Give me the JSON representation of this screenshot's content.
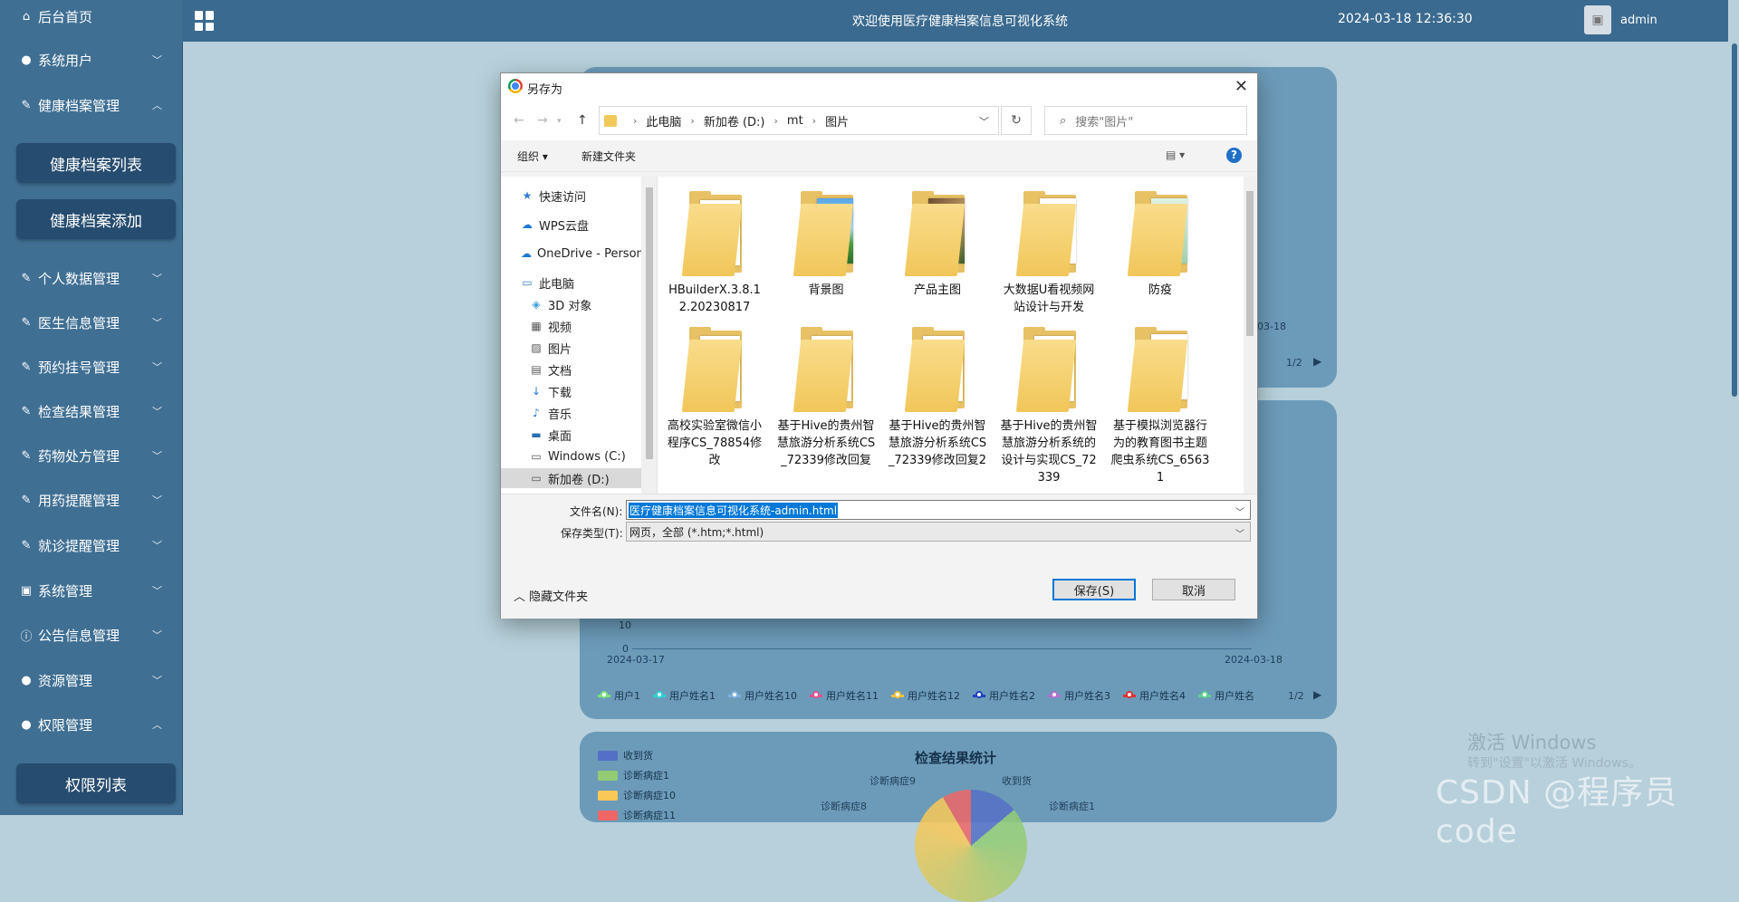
{
  "sidebar": {
    "items": [
      {
        "label": "后台首页",
        "icon": "home-icon"
      },
      {
        "label": "系统用户",
        "icon": "user-icon",
        "chevron": "﹀"
      },
      {
        "label": "健康档案管理",
        "icon": "edit-icon",
        "chevron": "︿"
      },
      {
        "label": "个人数据管理",
        "icon": "edit-icon",
        "chevron": "﹀"
      },
      {
        "label": "医生信息管理",
        "icon": "edit-icon",
        "chevron": "﹀"
      },
      {
        "label": "预约挂号管理",
        "icon": "edit-icon",
        "chevron": "﹀"
      },
      {
        "label": "检查结果管理",
        "icon": "edit-icon",
        "chevron": "﹀"
      },
      {
        "label": "药物处方管理",
        "icon": "edit-icon",
        "chevron": "﹀"
      },
      {
        "label": "用药提醒管理",
        "icon": "edit-icon",
        "chevron": "﹀"
      },
      {
        "label": "就诊提醒管理",
        "icon": "edit-icon",
        "chevron": "﹀"
      },
      {
        "label": "系统管理",
        "icon": "image-icon",
        "chevron": "﹀"
      },
      {
        "label": "公告信息管理",
        "icon": "info-icon",
        "chevron": "﹀"
      },
      {
        "label": "资源管理",
        "icon": "bulb-icon",
        "chevron": "﹀"
      },
      {
        "label": "权限管理",
        "icon": "user-icon",
        "chevron": "︿"
      }
    ],
    "sub_buttons": [
      "健康档案列表",
      "健康档案添加",
      "权限列表"
    ]
  },
  "header": {
    "title": "欢迎使用医疗健康档案信息可视化系统",
    "datetime": "2024-03-18 12:36:30",
    "username": "admin"
  },
  "background": {
    "panel1": {
      "date": "03-18",
      "pager": "1/2"
    },
    "chart2": {
      "y_ticks": [
        "10",
        "0"
      ],
      "x_start": "2024-03-17",
      "x_end": "2024-03-18",
      "pager": "1/2",
      "legend": [
        {
          "name": "用户1",
          "color": "#7ee37e"
        },
        {
          "name": "用户姓名1",
          "color": "#2fd0d0"
        },
        {
          "name": "用户姓名10",
          "color": "#7fb0e0"
        },
        {
          "name": "用户姓名11",
          "color": "#e0508e"
        },
        {
          "name": "用户姓名12",
          "color": "#f0c040"
        },
        {
          "name": "用户姓名2",
          "color": "#2040c0"
        },
        {
          "name": "用户姓名3",
          "color": "#b070d0"
        },
        {
          "name": "用户姓名4",
          "color": "#e03030"
        },
        {
          "name": "用户姓名",
          "color": "#60d090"
        }
      ]
    },
    "chart3": {
      "title": "检查结果统计",
      "legend": [
        {
          "name": "收到货",
          "color": "#5470c6"
        },
        {
          "name": "诊断病症1",
          "color": "#91cc75"
        },
        {
          "name": "诊断病症10",
          "color": "#fac858"
        },
        {
          "name": "诊断病症11",
          "color": "#ee6666"
        }
      ],
      "labels": [
        "诊断病症9",
        "收到货",
        "诊断病症8",
        "诊断病症1"
      ]
    }
  },
  "watermark": {
    "activate": "激活 Windows",
    "activate_sub": "转到\"设置\"以激活 Windows。",
    "csdn": "CSDN @程序员code"
  },
  "dialog": {
    "title": "另存为",
    "close": "✕",
    "breadcrumb": [
      "此电脑",
      "新加卷 (D:)",
      "mt",
      "图片"
    ],
    "search_placeholder": "搜索\"图片\"",
    "toolbar": {
      "organize": "组织 ▾",
      "new_folder": "新建文件夹",
      "help": "?"
    },
    "nav_pane": [
      {
        "label": "快速访问",
        "icon": "star-icon"
      },
      {
        "label": "WPS云盘",
        "icon": "cloud-icon"
      },
      {
        "label": "OneDrive - Person",
        "icon": "cloud-icon"
      },
      {
        "label": "此电脑",
        "icon": "computer-icon"
      },
      {
        "label": "3D 对象",
        "icon": "cube-icon"
      },
      {
        "label": "视频",
        "icon": "video-icon"
      },
      {
        "label": "图片",
        "icon": "picture-icon"
      },
      {
        "label": "文档",
        "icon": "document-icon"
      },
      {
        "label": "下载",
        "icon": "download-icon"
      },
      {
        "label": "音乐",
        "icon": "music-icon"
      },
      {
        "label": "桌面",
        "icon": "desktop-icon"
      },
      {
        "label": "Windows (C:)",
        "icon": "drive-icon"
      },
      {
        "label": "新加卷 (D:)",
        "icon": "drive-icon",
        "selected": true
      }
    ],
    "folders": [
      {
        "label": "HBuilderX.3.8.12.20230817",
        "thumb": "plain"
      },
      {
        "label": "背景图",
        "thumb": "landscape"
      },
      {
        "label": "产品主图",
        "thumb": "photo"
      },
      {
        "label": "大数据U看视频网站设计与开发",
        "thumb": "wps"
      },
      {
        "label": "防疫",
        "thumb": "green"
      },
      {
        "label": "高校实验室微信小程序CS_78854修改",
        "thumb": "plain"
      },
      {
        "label": "基于Hive的贵州智慧旅游分析系统CS_72339修改回复",
        "thumb": "doc"
      },
      {
        "label": "基于Hive的贵州智慧旅游分析系统CS_72339修改回复2",
        "thumb": "doc"
      },
      {
        "label": "基于Hive的贵州智慧旅游分析系统的设计与实现CS_72339",
        "thumb": "doc"
      },
      {
        "label": "基于模拟浏览器行为的教育图书主题爬虫系统CS_65631",
        "thumb": "excel"
      }
    ],
    "filename_label": "文件名(N):",
    "filename_value": "医疗健康档案信息可视化系统-admin.html",
    "filetype_label": "保存类型(T):",
    "filetype_value": "网页，全部 (*.htm;*.html)",
    "hide_folders": "隐藏文件夹",
    "save": "保存(S)",
    "cancel": "取消"
  }
}
